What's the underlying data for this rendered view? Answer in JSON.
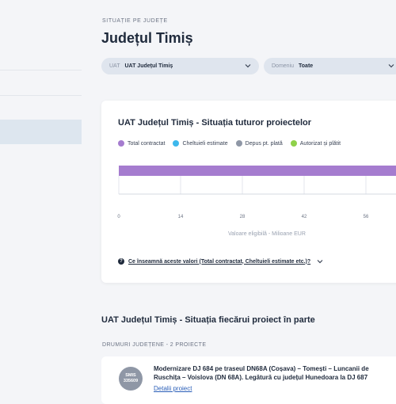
{
  "header": {
    "eyebrow": "SITUAȚIE PE JUDEȚE",
    "title": "Județul Timiș"
  },
  "filters": [
    {
      "label": "UAT",
      "value": "UAT Județul Timiș"
    },
    {
      "label": "Domeniu",
      "value": "Toate"
    }
  ],
  "summary_card": {
    "title": "UAT Județul Timiș - Situația tuturor proiectelor",
    "legend": [
      {
        "label": "Total contractat",
        "color": "#a57ccf"
      },
      {
        "label": "Cheltuieli estimate",
        "color": "#3db8ec"
      },
      {
        "label": "Depus pt. plată",
        "color": "#8f97a6"
      },
      {
        "label": "Autorizat și plătit",
        "color": "#8fd14a"
      }
    ],
    "faq": "Ce înseamnă aceste valori (Total contractat, Cheltuieli estimate etc.)?"
  },
  "chart_data": {
    "type": "bar",
    "orientation": "horizontal",
    "series": [
      {
        "name": "Total contractat",
        "values": [
          75
        ]
      }
    ],
    "xticks": [
      0,
      14,
      28,
      42,
      56
    ],
    "xlim": [
      0,
      70
    ],
    "xlabel": "Valoare eligibilă - Milioane EUR",
    "grid": true
  },
  "projects_section": {
    "title": "UAT Județul Timiș - Situația fiecărui proiect în parte",
    "group": "DRUMURI JUDEȚENE - 2 PROIECTE",
    "projects": [
      {
        "smis_label": "SMIS",
        "smis_code": "335609",
        "title_line1": "Modernizare DJ 684 pe traseul DN68A (Coșava) – Tomești – Luncanii de",
        "title_line2": "Ruschița – Voislova (DN 68A). Legătură cu județul Hunedoara la DJ 687",
        "link": "Detalii proiect"
      }
    ]
  }
}
